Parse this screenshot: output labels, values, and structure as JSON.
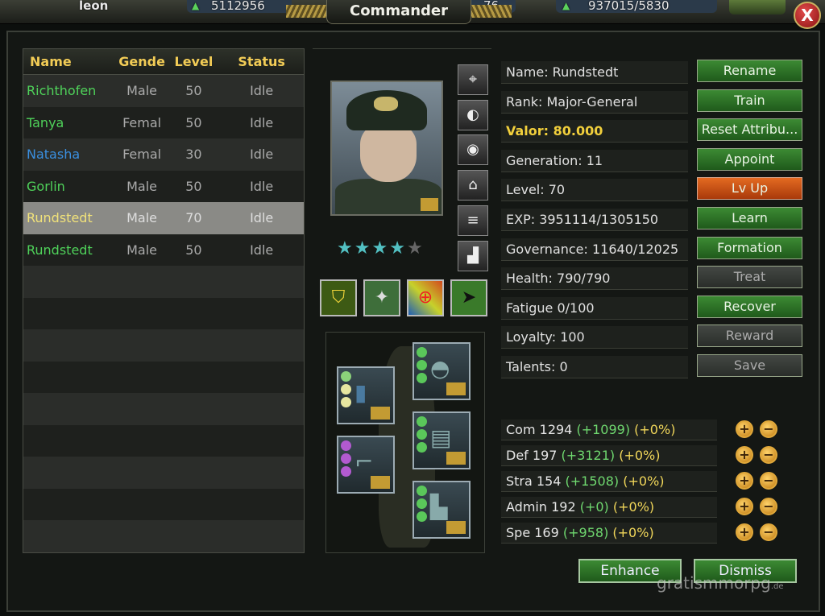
{
  "topbar": {
    "player_name": "leon",
    "resource1": "5112956",
    "resource2": "76",
    "resource3": "937015/5830",
    "close_glyph": "X"
  },
  "window": {
    "title": "Commander"
  },
  "list": {
    "headers": {
      "name": "Name",
      "gender": "Gende",
      "level": "Level",
      "status": "Status"
    },
    "rows": [
      {
        "name": "Richthofen",
        "gender": "Male",
        "level": "50",
        "status": "Idle",
        "name_color": "#4fd25a"
      },
      {
        "name": "Tanya",
        "gender": "Femal",
        "level": "50",
        "status": "Idle",
        "name_color": "#4fd25a"
      },
      {
        "name": "Natasha",
        "gender": "Femal",
        "level": "30",
        "status": "Idle",
        "name_color": "#3a8fe0"
      },
      {
        "name": "Gorlin",
        "gender": "Male",
        "level": "50",
        "status": "Idle",
        "name_color": "#4fd25a"
      },
      {
        "name": "Rundstedt",
        "gender": "Male",
        "level": "70",
        "status": "Idle",
        "name_color": "#f1e27a"
      },
      {
        "name": "Rundstedt",
        "gender": "Male",
        "level": "50",
        "status": "Idle",
        "name_color": "#4fd25a"
      }
    ]
  },
  "commander": {
    "name": "Name: Rundstedt",
    "rank": "Rank: Major-General",
    "valor": "Valor: 80.000",
    "generation": "Generation: 11",
    "level": "Level: 70",
    "exp": "EXP: 3951114/1305150",
    "governance": "Governance: 11640/12025",
    "health": "Health: 790/790",
    "fatigue": "Fatigue   0/100",
    "loyalty": "Loyalty: 100",
    "talents": "Talents: 0",
    "stars": {
      "filled": 4,
      "total": 5
    }
  },
  "buttons": {
    "rename": "Rename",
    "train": "Train",
    "reset": "Reset Attribu...",
    "appoint": "Appoint",
    "lvup": "Lv Up",
    "learn": "Learn",
    "formation": "Formation",
    "treat": "Treat",
    "recover": "Recover",
    "reward": "Reward",
    "save": "Save",
    "enhance": "Enhance",
    "dismiss": "Dismiss"
  },
  "attributes": [
    {
      "label": "Com 1294",
      "bonus": "(+1099)",
      "pct": "(+0%)"
    },
    {
      "label": "Def 197",
      "bonus": "(+3121)",
      "pct": "(+0%)"
    },
    {
      "label": "Stra 154",
      "bonus": "(+1508)",
      "pct": "(+0%)"
    },
    {
      "label": "Admin 192",
      "bonus": "(+0)",
      "pct": "(+0%)"
    },
    {
      "label": "Spe 169",
      "bonus": "(+958)",
      "pct": "(+0%)"
    }
  ],
  "plus_glyph": "+",
  "minus_glyph": "−",
  "watermark": {
    "main": "gratismmorpg",
    "suffix": ".de"
  },
  "colors": {
    "accent_green": "#3c8a33",
    "lvup_orange": "#e36a21",
    "header_gold": "#f2cc56"
  }
}
